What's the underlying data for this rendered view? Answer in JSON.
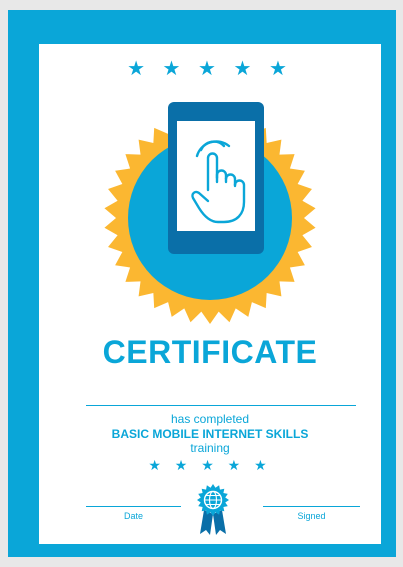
{
  "certificate": {
    "stars_top": "★ ★ ★ ★ ★",
    "title": "CERTIFICATE",
    "line1": "has completed",
    "course": "BASIC MOBILE INTERNET SKILLS",
    "line3": "training",
    "stars_bottom": "★ ★ ★ ★ ★",
    "date_label": "Date",
    "signed_label": "Signed",
    "badge_icon": "phone-tap-icon",
    "seal_icon": "globe-ribbon-icon"
  },
  "colors": {
    "primary": "#0aa6d8",
    "dark_blue": "#0a6fa8",
    "gold": "#fbb731",
    "background": "#e8e8e8",
    "paper": "#ffffff"
  }
}
